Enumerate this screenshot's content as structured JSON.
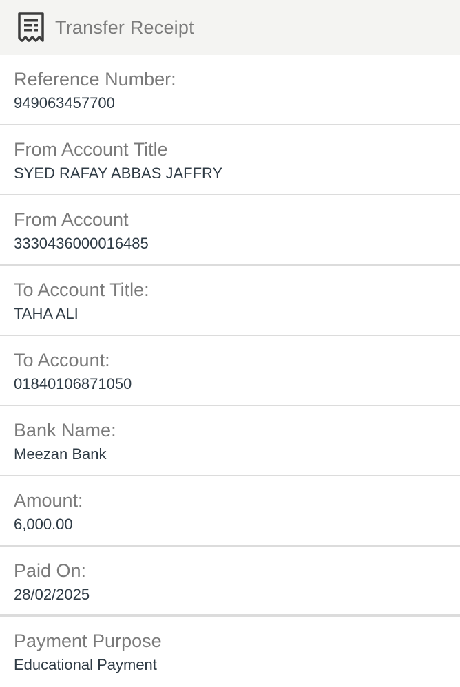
{
  "header": {
    "title": "Transfer Receipt",
    "icon": "receipt-icon"
  },
  "fields": [
    {
      "label": "Reference Number:",
      "value": "949063457700"
    },
    {
      "label": "From Account Title",
      "value": "SYED RAFAY ABBAS JAFFRY"
    },
    {
      "label": "From Account",
      "value": "3330436000016485"
    },
    {
      "label": "To Account Title:",
      "value": "TAHA ALI"
    },
    {
      "label": "To Account:",
      "value": "01840106871050"
    },
    {
      "label": "Bank Name:",
      "value": "Meezan Bank"
    },
    {
      "label": "Amount:",
      "value": "6,000.00"
    },
    {
      "label": "Paid On:",
      "value": "28/02/2025"
    },
    {
      "label": "Payment Purpose",
      "value": "Educational Payment"
    }
  ]
}
